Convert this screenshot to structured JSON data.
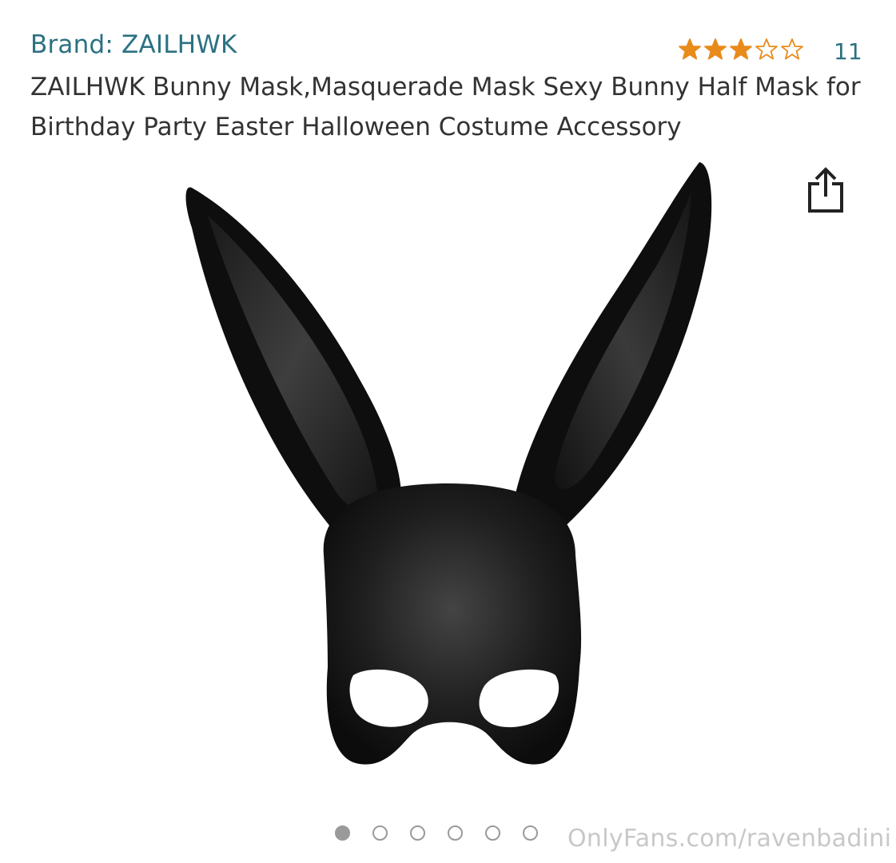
{
  "product": {
    "brand_label": "Brand: ZAILHWK",
    "title": "ZAILHWK Bunny Mask,Masquerade Mask Sexy Bunny Half Mask for Birthday Party Easter Halloween Costume Accessory",
    "rating": 3.0,
    "rating_max": 5,
    "review_count": "11",
    "image_subject": "black bunny mask"
  },
  "carousel": {
    "total": 6,
    "active_index": 0
  },
  "icons": {
    "share": "share-icon",
    "star_filled": "star-filled-icon",
    "star_empty": "star-empty-icon"
  },
  "colors": {
    "link": "#2b7182",
    "star": "#e88b1b",
    "text": "#333333",
    "dot": "#9a9a9a",
    "watermark": "#c8c8c8"
  },
  "watermark": "OnlyFans.com/ravenbadini"
}
